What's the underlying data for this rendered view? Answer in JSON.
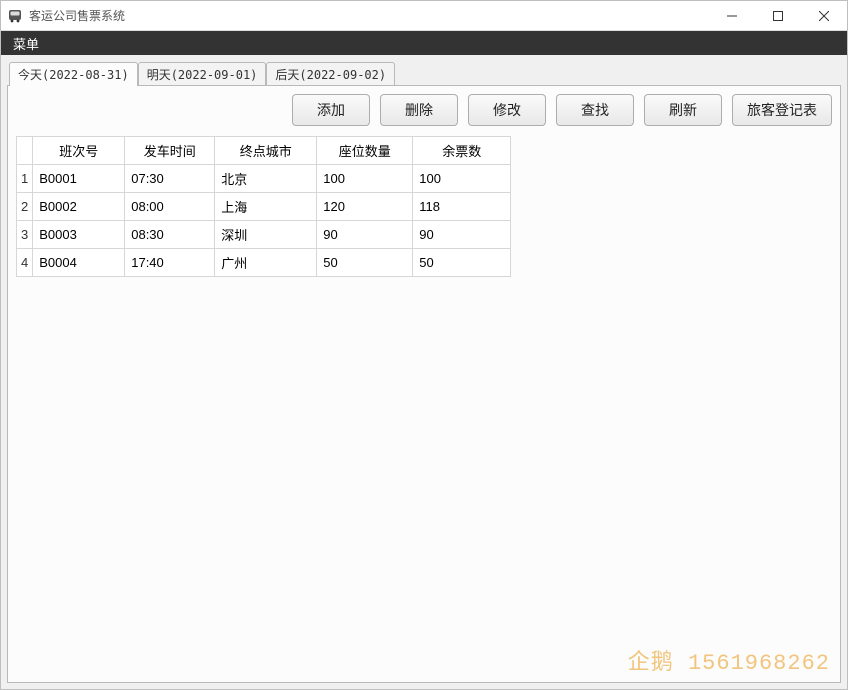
{
  "window": {
    "title": "客运公司售票系统"
  },
  "menubar": {
    "items": [
      "菜单"
    ]
  },
  "tabs": [
    {
      "label": "今天(2022-08-31)",
      "active": true
    },
    {
      "label": "明天(2022-09-01)",
      "active": false
    },
    {
      "label": "后天(2022-09-02)",
      "active": false
    }
  ],
  "toolbar": {
    "add": "添加",
    "delete": "删除",
    "edit": "修改",
    "search": "查找",
    "refresh": "刷新",
    "passenger": "旅客登记表"
  },
  "table": {
    "headers": {
      "bus_no": "班次号",
      "depart_time": "发车时间",
      "dest_city": "终点城市",
      "seat_count": "座位数量",
      "remaining": "余票数"
    },
    "rows": [
      {
        "n": "1",
        "bus_no": "B0001",
        "depart_time": "07:30",
        "dest_city": "北京",
        "seat_count": "100",
        "remaining": "100"
      },
      {
        "n": "2",
        "bus_no": "B0002",
        "depart_time": "08:00",
        "dest_city": "上海",
        "seat_count": "120",
        "remaining": "118"
      },
      {
        "n": "3",
        "bus_no": "B0003",
        "depart_time": "08:30",
        "dest_city": "深圳",
        "seat_count": "90",
        "remaining": "90"
      },
      {
        "n": "4",
        "bus_no": "B0004",
        "depart_time": "17:40",
        "dest_city": "广州",
        "seat_count": "50",
        "remaining": "50"
      }
    ]
  },
  "watermark": "企鹅 1561968262"
}
